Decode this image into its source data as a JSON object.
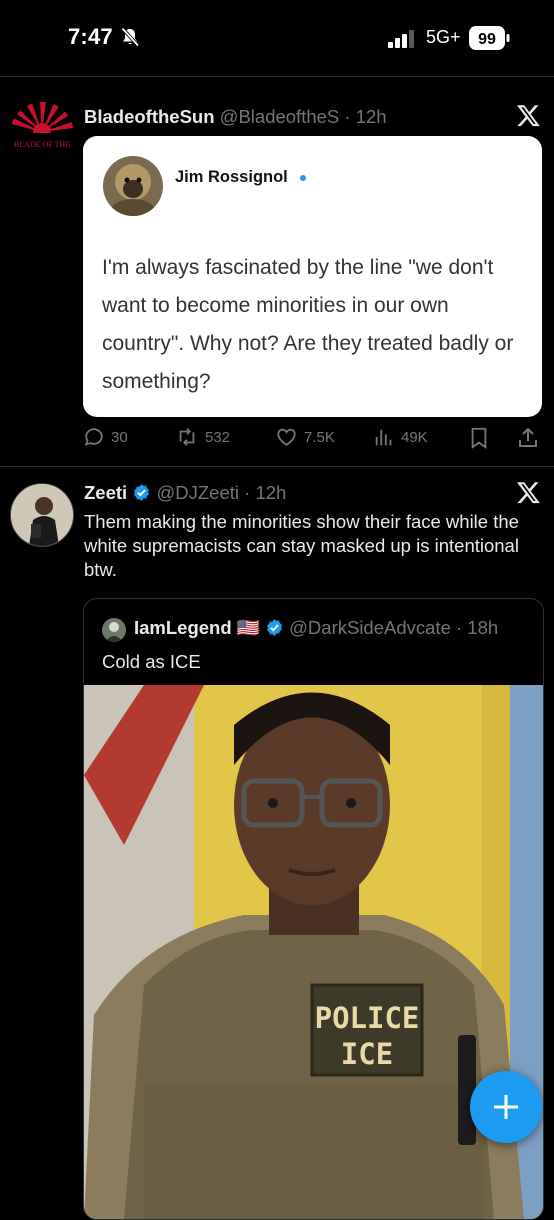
{
  "status_bar": {
    "time": "7:47",
    "network": "5G+",
    "battery": "99"
  },
  "tweets": [
    {
      "display_name": "BladeoftheSun",
      "handle": "@BladeoftheS",
      "time": "· 12h",
      "avatar_text": "BLADE OF THE",
      "embedded_screenshot": {
        "author": "Jim Rossignol",
        "text": "I'm always fascinated by the line \"we don't want to become minorities in our own country\". Why not? Are they treated badly or something?"
      },
      "actions": {
        "replies": "30",
        "reposts": "532",
        "likes": "7.5K",
        "views": "49K"
      }
    },
    {
      "display_name": "Zeeti",
      "handle": "@DJZeeti",
      "time": "· 12h",
      "text": "Them making the minorities show their face while the white supremacists can stay masked up is intentional btw.",
      "quote": {
        "display_name": "IamLegend",
        "flag": "🇺🇸",
        "handle": "@DarkSideAdvcate",
        "time": "· 18h",
        "text": "Cold as ICE",
        "image_patch": "POLICE ICE"
      }
    }
  ],
  "colors": {
    "accent": "#1d9bf0",
    "background": "#000000",
    "secondary_text": "#71767b"
  },
  "icons": [
    "bell-slash-icon",
    "signal-icon",
    "battery-icon",
    "x-logo-icon",
    "reply-icon",
    "repost-icon",
    "like-icon",
    "views-icon",
    "bookmark-icon",
    "share-icon",
    "verified-badge-icon",
    "plus-icon"
  ]
}
